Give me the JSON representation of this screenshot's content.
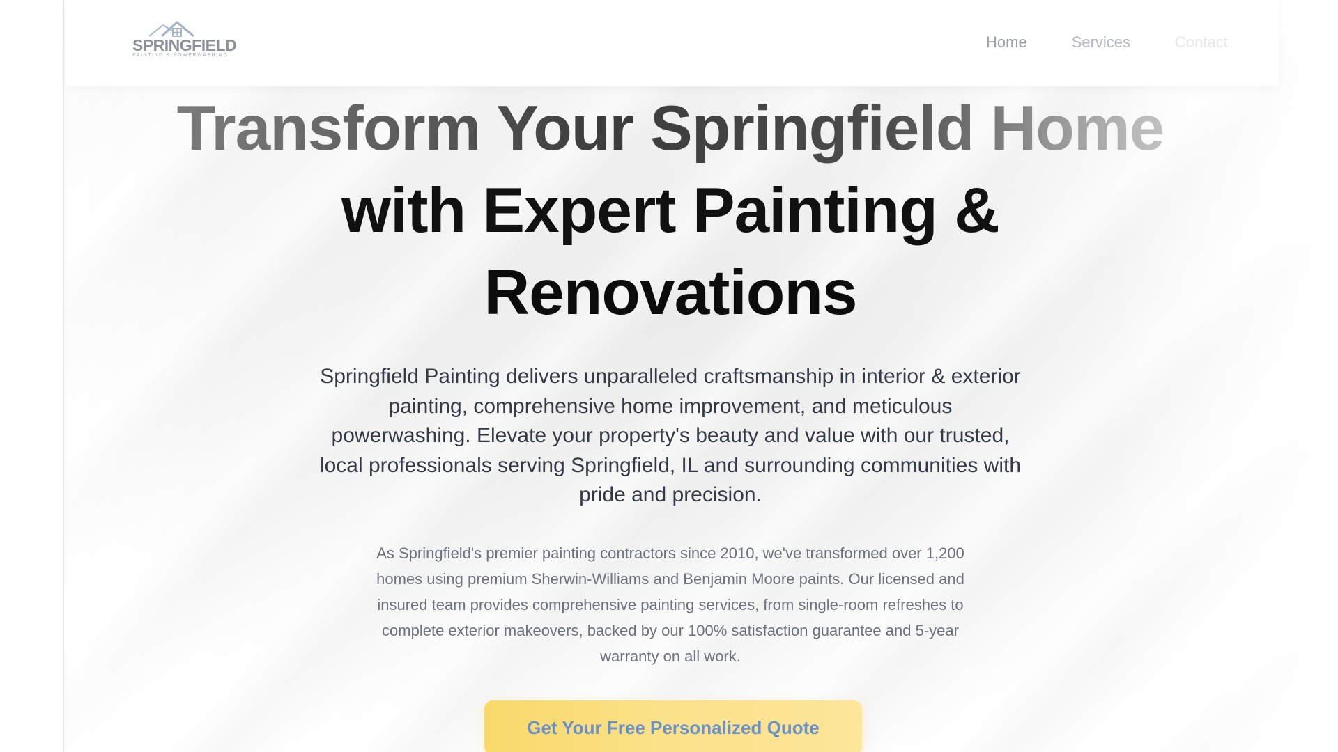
{
  "brand": {
    "logo_name": "SPRINGFIELD",
    "logo_tagline": "PAINTING & POWERWASHING"
  },
  "nav": {
    "items": [
      {
        "label": "Home"
      },
      {
        "label": "Services"
      },
      {
        "label": "Contact"
      }
    ]
  },
  "hero": {
    "headline_line1": "Transform Your Springfield Home",
    "headline_line2": "with Expert Painting &",
    "headline_line3": "Renovations",
    "lead": "Springfield Painting delivers unparalleled craftsmanship in interior & exterior painting, comprehensive home improvement, and meticulous powerwashing. Elevate your property's beauty and value with our trusted, local professionals serving Springfield, IL and surrounding communities with pride and precision.",
    "support": "As Springfield's premier painting contractors since 2010, we've transformed over 1,200 homes using premium Sherwin-Williams and Benjamin Moore paints. Our licensed and insured team provides comprehensive painting services, from single-room refreshes to complete exterior makeovers, backed by our 100% satisfaction guarantee and 5-year warranty on all work.",
    "cta_label": "Get Your Free Personalized Quote"
  },
  "colors": {
    "cta_background": "#fbe28a",
    "cta_text": "#6b8fc7",
    "headline": "#111111",
    "body_text": "#333a45",
    "muted_text": "#6c727b",
    "nav_text": "#9aa0a8"
  },
  "icons": {
    "logo_mark": "house-roof-icon"
  }
}
